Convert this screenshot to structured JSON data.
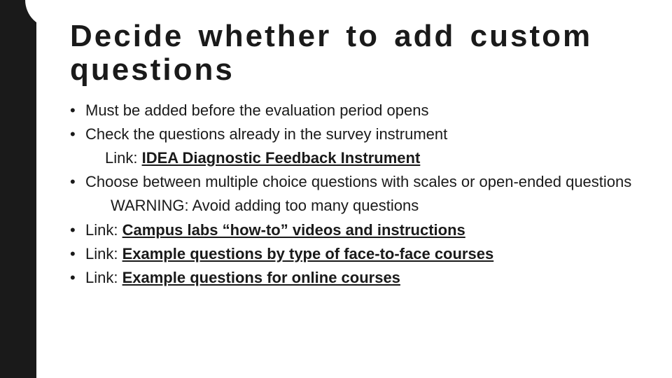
{
  "title": "Decide whether to add custom questions",
  "bullets": {
    "b1": "Must be added before the evaluation period opens",
    "b2": "Check the questions already in the survey instrument",
    "b2_sub_prefix": "Link: ",
    "b2_sub_link": "IDEA Diagnostic Feedback Instrument",
    "b3": "Choose between multiple choice questions with scales or open-ended questions",
    "b3_warning": "WARNING:  Avoid adding too many questions",
    "b4_prefix": "Link: ",
    "b4_link": "Campus labs “how-to” videos and instructions",
    "b5_prefix": "Link: ",
    "b5_link": "Example questions by type of face-to-face courses",
    "b6_prefix": "Link: ",
    "b6_link": "Example questions for online courses"
  }
}
